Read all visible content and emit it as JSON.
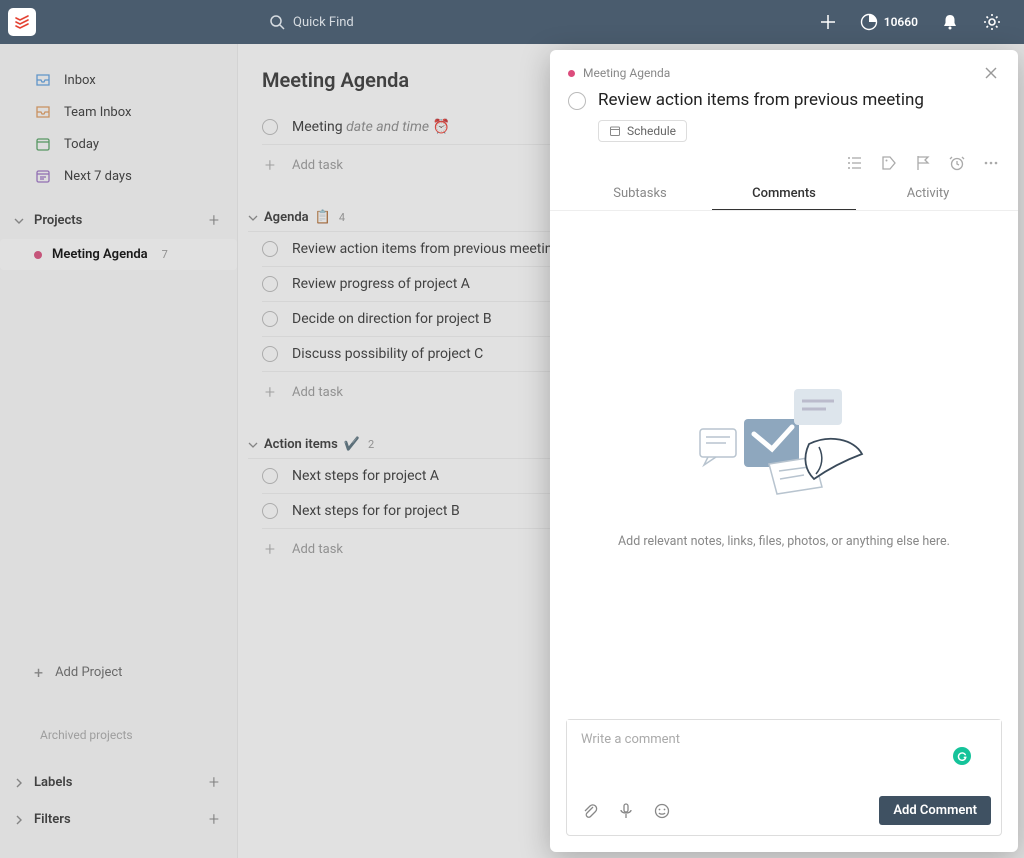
{
  "colors": {
    "accent": "#e44232",
    "projectDot": "#dc4c7c",
    "topbar": "#4a5c6e"
  },
  "topbar": {
    "search_placeholder": "Quick Find",
    "karma": "10660"
  },
  "sidebar": {
    "nav": [
      {
        "label": "Inbox"
      },
      {
        "label": "Team Inbox"
      },
      {
        "label": "Today"
      },
      {
        "label": "Next 7 days"
      }
    ],
    "projects_header": "Projects",
    "projects": [
      {
        "label": "Meeting Agenda",
        "count": "7"
      }
    ],
    "add_project": "Add Project",
    "archived": "Archived projects",
    "bottom_sections": [
      {
        "label": "Labels"
      },
      {
        "label": "Filters"
      }
    ]
  },
  "content": {
    "title": "Meeting Agenda",
    "untitled_section": {
      "tasks": [
        {
          "prefix": "Meeting ",
          "italic": "date and time ",
          "emoji": "⏰"
        }
      ]
    },
    "sections": [
      {
        "name": "Agenda",
        "emoji": "📋",
        "count": "4",
        "tasks": [
          {
            "label": "Review action items from previous meeting"
          },
          {
            "label": "Review progress of project A"
          },
          {
            "label": "Decide on direction for project B"
          },
          {
            "label": "Discuss possibility of project C"
          }
        ]
      },
      {
        "name": "Action items ",
        "emoji": "✔️",
        "count": "2",
        "tasks": [
          {
            "label": "Next steps for project A"
          },
          {
            "label": "Next steps for for project B"
          }
        ]
      }
    ],
    "add_task": "Add task"
  },
  "panel": {
    "breadcrumb": "Meeting Agenda",
    "task_title": "Review action items from previous meeting",
    "schedule": "Schedule",
    "tabs": {
      "subtasks": "Subtasks",
      "comments": "Comments",
      "activity": "Activity"
    },
    "empty_text": "Add relevant notes, links, files, photos, or anything else here.",
    "comment_placeholder": "Write a comment",
    "add_comment": "Add Comment"
  }
}
